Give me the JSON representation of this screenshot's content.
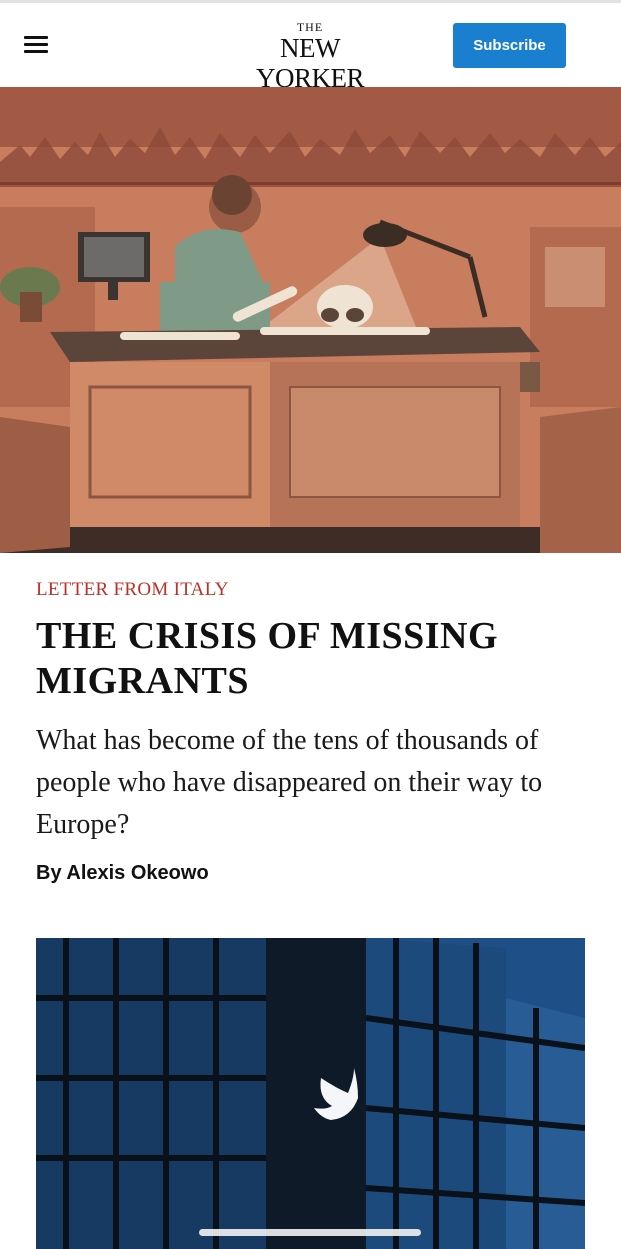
{
  "header": {
    "logo_the": "THE",
    "logo_name": "NEW YORKER",
    "subscribe_label": "Subscribe",
    "menu_icon": "hamburger-menu-icon"
  },
  "article": {
    "rubric": "LETTER FROM ITALY",
    "headline": "THE CRISIS OF MISSING MIGRANTS",
    "dek": "What has become of the tens of thousands of people who have disappeared on their way to Europe?",
    "byline": "By Alexis Okeowo"
  },
  "colors": {
    "rubric": "#b8322a",
    "subscribe_bg": "#1a7fcf",
    "hero_wall": "#c97d5f"
  }
}
